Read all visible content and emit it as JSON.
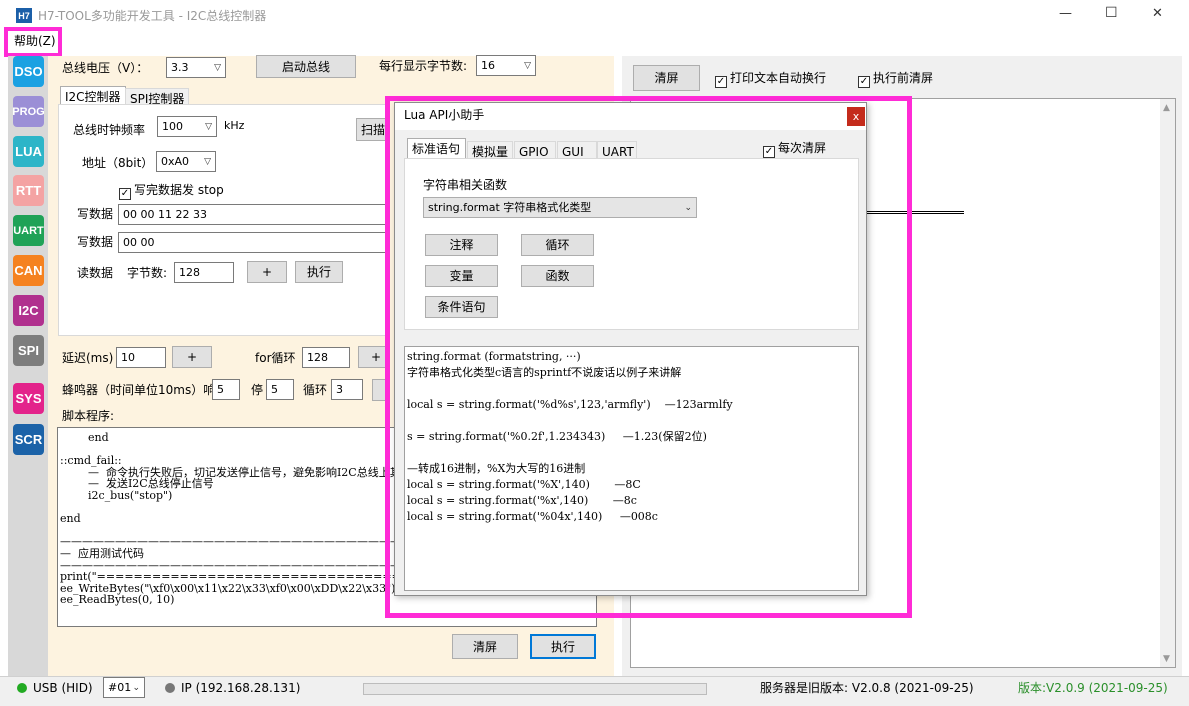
{
  "window": {
    "title": "H7-TOOL多功能开发工具 - I2C总线控制器",
    "logo": "H7",
    "min_glyph": "—",
    "max_glyph": "☐",
    "close_glyph": "✕"
  },
  "menu": {
    "help": "帮助(Z)"
  },
  "sidebar": {
    "items": [
      {
        "label": "DSO",
        "color": "#1ba1e2"
      },
      {
        "label": "PROG",
        "color": "#9b8fd6"
      },
      {
        "label": "LUA",
        "color": "#2db5c8"
      },
      {
        "label": "RTT",
        "color": "#f4a3a3"
      },
      {
        "label": "UART",
        "color": "#1fa257"
      },
      {
        "label": "CAN",
        "color": "#f58220"
      },
      {
        "label": "I2C",
        "color": "#b0308e"
      },
      {
        "label": "SPI",
        "color": "#7d7d7d"
      },
      {
        "label": "SYS",
        "color": "#e3238b"
      },
      {
        "label": "SCR",
        "color": "#1b62a8"
      }
    ]
  },
  "top": {
    "voltage_label": "总线电压（V）：",
    "voltage_value": "3.3",
    "start_bus": "启动总线",
    "bytes_per_line_label": "每行显示字节数:",
    "bytes_per_line_value": "16"
  },
  "tabs": {
    "i2c": "I2C控制器",
    "spi": "SPI控制器"
  },
  "i2c": {
    "clock_label": "总线时钟频率",
    "clock_value": "100",
    "clock_unit": "kHz",
    "scan_button": "扫描",
    "addr_label": "地址（8bit）",
    "addr_value": "0xA0",
    "stop_check": "✓",
    "stop_label": "写完数据发 stop",
    "write_label": "写数据",
    "write1_value": "00 00 11 22 33",
    "write2_label": "写数据",
    "write2_value": "00 00",
    "read_label": "读数据",
    "bytes_label": "字节数:",
    "bytes_value": "128",
    "plus": "+",
    "exec": "执行"
  },
  "lower": {
    "delay_label": "延迟(ms)",
    "delay_value": "10",
    "plus": "+",
    "loop_label": "for循环",
    "loop_value": "128",
    "plus2": "+",
    "buzzer_label": "蜂鸣器（时间单位10ms）响",
    "buzzer_on": "5",
    "stop_label": "停",
    "buzzer_off": "5",
    "cycle_label": "循环",
    "cycle_value": "3",
    "script_label": "脚本程序:",
    "clear": "清屏",
    "exec": "执行"
  },
  "script_lines": [
    "        end",
    "",
    "::cmd_fail::",
    "        —  命令执行失败后，切记发送停止信号，避免影响I2C总线上其他设备",
    "        —  发送I2C总线停止信号",
    "        i2c_bus(\"stop\")",
    "",
    "end",
    "",
    "————————————————————————————————————",
    "—  应用测试代码",
    "————————————————————————————————————",
    "print(\"=======================================\")",
    "ee_WriteBytes(\"\\xf0\\x00\\x11\\x22\\x33\\xf0\\x00\\xDD\\x22\\x33\")",
    "ee_ReadBytes(0, 10)"
  ],
  "right": {
    "clear": "清屏",
    "wrap_check": "✓",
    "wrap_label": "打印文本自动换行",
    "clear_before_check": "✓",
    "clear_before_label": "执行前清屏"
  },
  "dialog": {
    "title": "Lua API小助手",
    "close": "x",
    "tabs": [
      "标准语句",
      "模拟量",
      "GPIO",
      "GUI",
      "UART"
    ],
    "clear_each_check": "✓",
    "clear_each_label": "每次清屏",
    "group_label": "字符串相关函数",
    "select_value": "string.format 字符串格式化类型",
    "buttons": [
      "注释",
      "循环",
      "变量",
      "函数",
      "条件语句"
    ],
    "output_lines": [
      "string.format (formatstring, ···)",
      "字符串格式化类型c语言的sprintf不说废话以例子来讲解",
      "",
      "local s = string.format('%d%s',123,'armfly')    —123armlfy",
      "",
      "s = string.format('%0.2f',1.234343)     —1.23(保留2位)",
      "",
      "—转成16进制，%X为大写的16进制",
      "local s = string.format('%X',140)       —8C",
      "local s = string.format('%x',140)       —8c",
      "local s = string.format('%04x',140)     —008c"
    ]
  },
  "status": {
    "usb": "USB (HID)",
    "device": "#01",
    "ip": "IP (192.168.28.131)",
    "server": "服务器是旧版本: V2.0.8 (2021-09-25)",
    "version": "版本:V2.0.9 (2021-09-25)"
  },
  "colors": {
    "highlight": "#ff2bd6",
    "panel_bg": "#fdf3e0",
    "status_green": "#22aa22",
    "version_green": "#2a8f2a"
  }
}
